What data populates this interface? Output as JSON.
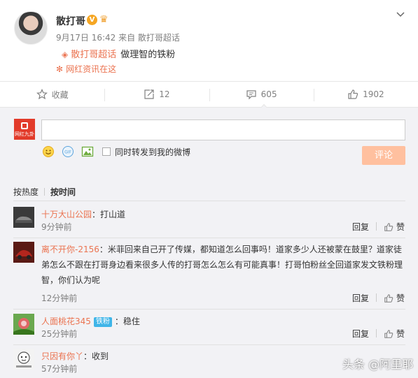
{
  "post": {
    "author": "散打哥",
    "v_badge": "V",
    "meta": "9月17日 16:42 来自 散打哥超话",
    "topic_link": "散打哥超话",
    "topic_text": "做理智的铁粉",
    "source_link": "网红资讯在这"
  },
  "actions": {
    "favorite": "收藏",
    "repost": "12",
    "comment": "605",
    "like": "1902"
  },
  "composer": {
    "avatar_text": "网红九卦",
    "input_value": "",
    "sync_label": "同时转发到我的微博",
    "submit_label": "评论"
  },
  "sort": {
    "hot": "按热度",
    "time": "按时间"
  },
  "comments": [
    {
      "user": "十万大山公园",
      "text": "：打山道",
      "time": "9分钟前"
    },
    {
      "user": "离不开你-2156",
      "text": "：米菲回来自己开了传媒，都知道怎么回事吗！道家多少人还被蒙在鼓里？道家徒弟怎么不跟在打哥身边看来很多人传的打哥怎么怎么有可能真事！打哥怕粉丝全回道家发文铁粉理智，你们认为呢",
      "time": "12分钟前"
    },
    {
      "user": "人面桃花345",
      "badge": "铁粉",
      "text": "：稳住",
      "time": "25分钟前"
    },
    {
      "user": "只因有你丫",
      "text": "：收到",
      "time": "57分钟前"
    }
  ],
  "labels": {
    "reply": "回复",
    "like": "赞"
  },
  "watermark": "头条 @阿里耶"
}
